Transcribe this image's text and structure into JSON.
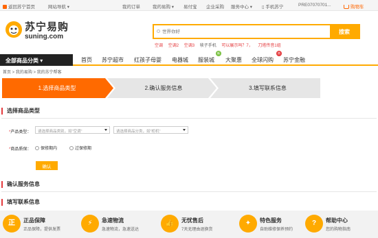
{
  "topbar": {
    "home": "返回苏宁首页",
    "sitenav": "网站导航",
    "orders": "我的订单",
    "mysuning": "我的易购",
    "epay": "易付宝",
    "enterprise": "企业采购",
    "service": "服务中心",
    "mobile": "手机苏宁",
    "user": "PRE07070701...",
    "cart": "购物车",
    "cart_count": "0"
  },
  "header": {
    "logo_cn": "苏宁易购",
    "logo_en": "suning.com",
    "search_placeholder": "世界你好",
    "search_button": "搜索",
    "hot": [
      "空调",
      "空调2",
      "空调3",
      "犊子手机",
      "可以展示吗？7，",
      "刀塔传音1组"
    ]
  },
  "nav": {
    "all": "全部商品分类",
    "links": [
      "首页",
      "苏宁超市",
      "红孩子母婴",
      "电器城",
      "服装城",
      "大聚惠",
      "全球闪购",
      "苏宁金融"
    ],
    "tag_new": "新",
    "tag_hot": "热"
  },
  "breadcrumb": "首页 > 我的易购 > 我的苏宁帮客",
  "steps": [
    "1.选择商品类型",
    "2.确认服务信息",
    "3.填写联系信息"
  ],
  "section1": {
    "title": "选择商品类型",
    "product_label": "产品类型：",
    "select1": "请选择商品类别，如\"空调\"",
    "select2": "请选择商品分类，如\"柜机\"",
    "warranty_label": "商品质保：",
    "radio_in": "保修期内",
    "radio_out": "过保修期",
    "confirm": "确认"
  },
  "section2": {
    "title": "确认服务信息"
  },
  "section3": {
    "title": "填写联系信息"
  },
  "features": [
    {
      "icon": "正",
      "title": "正品保障",
      "desc": "正品保障，提供发票"
    },
    {
      "icon": "⚡",
      "title": "急速物流",
      "desc": "急速物流，急速送达"
    },
    {
      "icon": "👍",
      "title": "无忧售后",
      "desc": "7天无理由退换货"
    },
    {
      "icon": "✦",
      "title": "特色服务",
      "desc": "自助维修保养预约"
    },
    {
      "icon": "?",
      "title": "帮助中心",
      "desc": "您的购物指南"
    }
  ],
  "colors": {
    "accent": "#ffaa00",
    "step_active": "#ff6a00",
    "step_inactive": "#e6e6e6",
    "nav_dark": "#222222"
  }
}
